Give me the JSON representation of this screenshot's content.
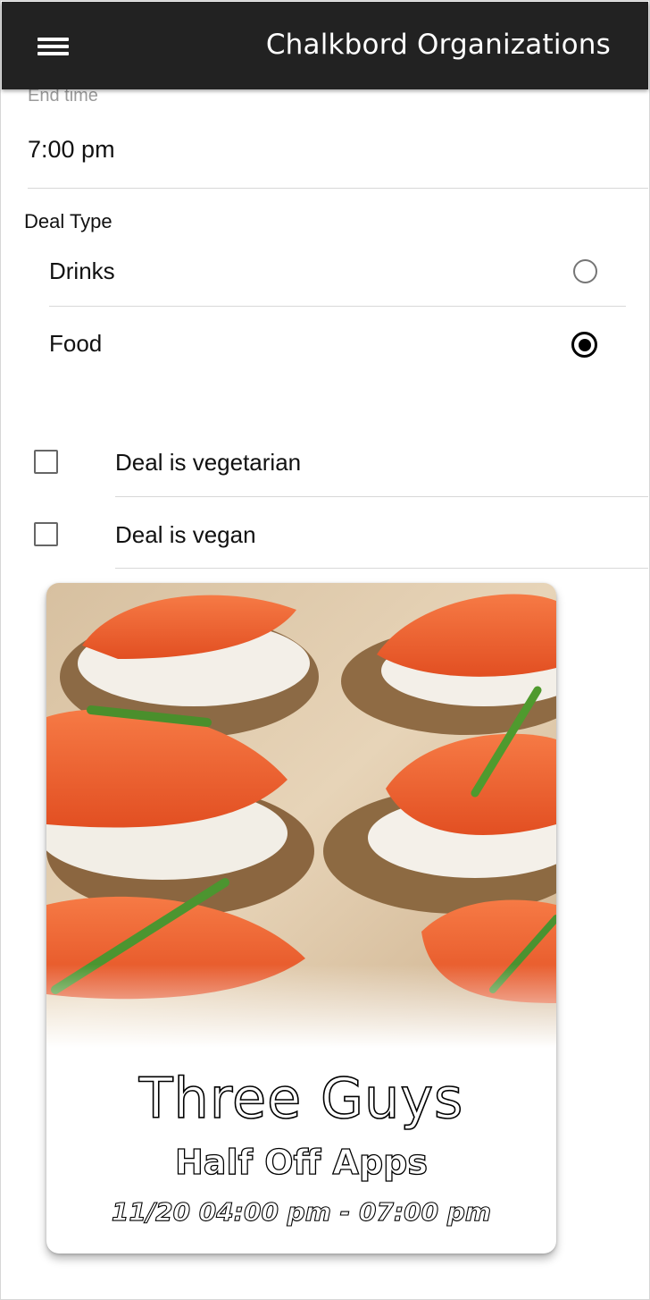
{
  "header": {
    "title": "Chalkbord Organizations",
    "menu_icon": "hamburger-menu-icon"
  },
  "end_time": {
    "label": "End time",
    "value": "7:00 pm"
  },
  "deal_type": {
    "label": "Deal Type",
    "options": [
      {
        "label": "Drinks",
        "selected": false
      },
      {
        "label": "Food",
        "selected": true
      }
    ]
  },
  "dietary": [
    {
      "label": "Deal is vegetarian",
      "checked": false
    },
    {
      "label": "Deal is vegan",
      "checked": false
    }
  ],
  "preview_card": {
    "image_icon": "smoked-salmon-canape-photo",
    "business_name": "Three Guys",
    "deal_name": "Half Off Apps",
    "time_range": "11/20 04:00 pm - 07:00 pm"
  },
  "colors": {
    "topbar": "#222222",
    "salmon": "#f0622f",
    "divider": "#d8d8d8"
  }
}
